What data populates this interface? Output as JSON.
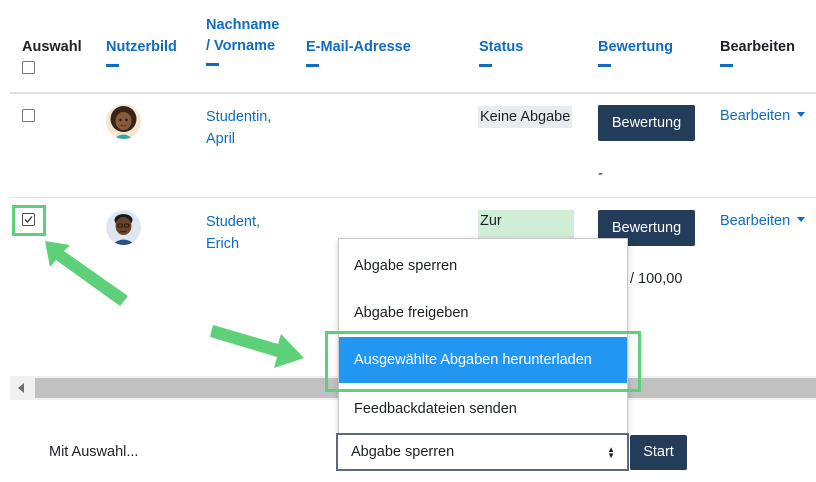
{
  "table": {
    "headers": {
      "select": "Auswahl",
      "picture": "Nutzerbild",
      "name_line1": "Nachname",
      "name_line2": "/ Vorname",
      "email": "E-Mail-Adresse",
      "status": "Status",
      "grade": "Bewertung",
      "edit": "Bearbeiten"
    },
    "rows": [
      {
        "checked": false,
        "name_line1": "Studentin,",
        "name_line2": "April",
        "status": "Keine Abgabe",
        "status_color": "#e9ecef",
        "grade_button": "Bewertung",
        "grade_value": "-",
        "edit_label": "Bearbeiten"
      },
      {
        "checked": true,
        "name_line1": "Student,",
        "name_line2": "Erich",
        "status": "Zur",
        "status_color": "#cfeed5",
        "grade_button": "Bewertung",
        "grade_value": "/ 100,00",
        "edit_label": "Bearbeiten"
      }
    ]
  },
  "dropdown_menu": {
    "items": [
      "Abgabe sperren",
      "Abgabe freigeben",
      "Ausgewählte Abgaben herunterladen",
      "Feedbackdateien senden"
    ],
    "active_index": 2
  },
  "bulk_action": {
    "label": "Mit Auswahl...",
    "selected_option": "Abgabe sperren",
    "start_button": "Start"
  },
  "colors": {
    "link": "#0f6cbf",
    "primary_button": "#233c5a",
    "menu_highlight": "#2196f3",
    "annotation_green": "#5fd07a"
  }
}
